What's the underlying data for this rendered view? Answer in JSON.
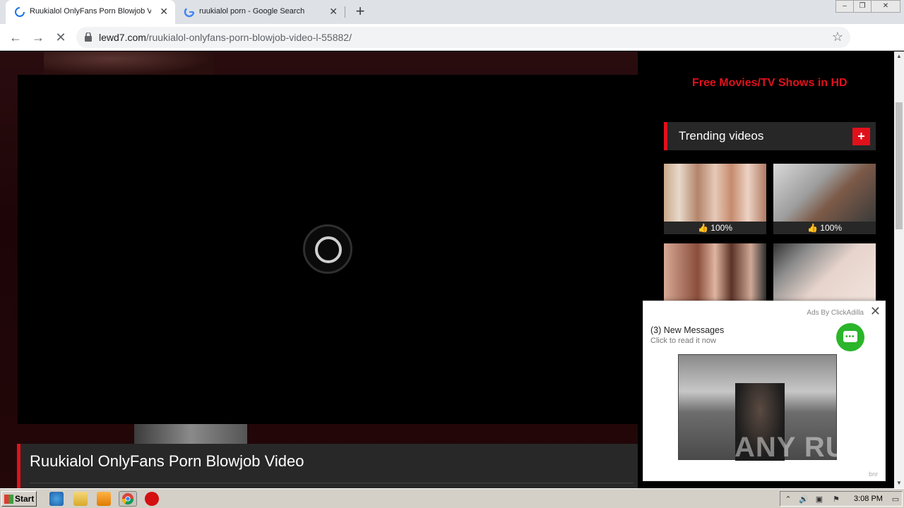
{
  "browser": {
    "tabs": [
      {
        "title": "Ruukialol OnlyFans Porn Blowjob Vid",
        "active": true
      },
      {
        "title": "ruukialol porn - Google Search",
        "active": false
      }
    ],
    "new_tab_label": "+",
    "url": {
      "host": "lewd7.com",
      "path": "/ruukialol-onlyfans-porn-blowjob-video-l-55882/"
    },
    "window_controls": {
      "minimize": "–",
      "restore": "❐",
      "close": "✕"
    }
  },
  "page": {
    "video_title": "Ruukialol OnlyFans Porn Blowjob Video",
    "sidebar": {
      "promo_link": "Free Movies/TV Shows in HD",
      "trending_heading": "Trending videos",
      "trending_plus": "+",
      "videos": [
        {
          "rating": "100%"
        },
        {
          "rating": "100%"
        },
        {
          "rating": ""
        },
        {
          "rating": ""
        }
      ]
    }
  },
  "ad_popup": {
    "ads_by": "Ads By ClickAdilla",
    "close": "✕",
    "message": "(3) New Messages",
    "sub": "Click to read it now",
    "bnr": "bnr"
  },
  "watermark": "ANY RUN",
  "taskbar": {
    "start_label": "Start",
    "clock": "3:08 PM"
  },
  "colors": {
    "accent": "#e1111c",
    "chat_green": "#2ab52a"
  }
}
